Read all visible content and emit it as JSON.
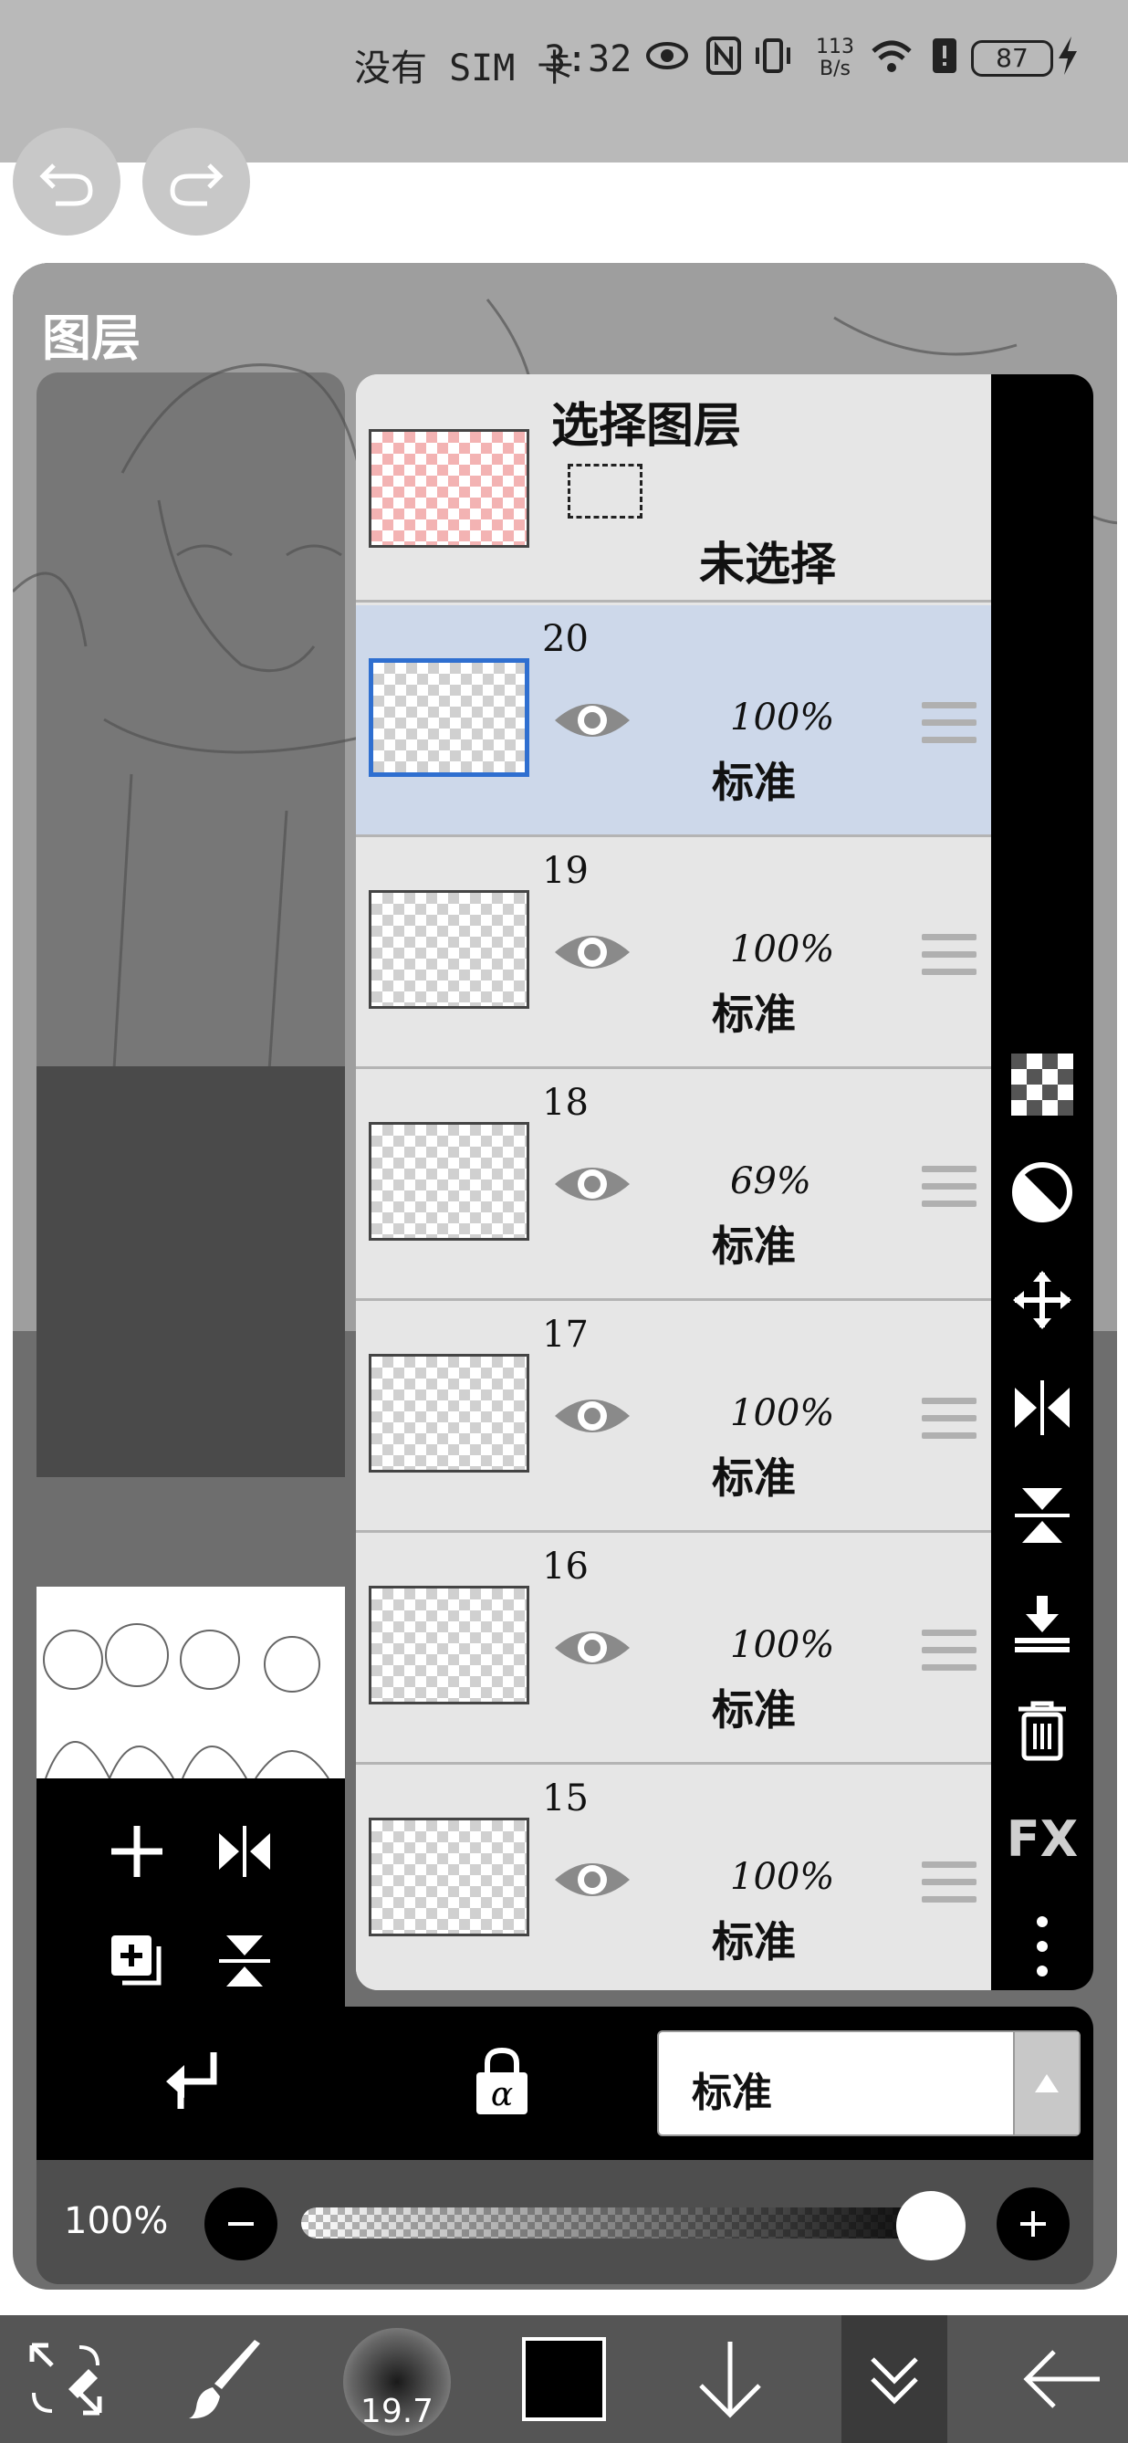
{
  "status_bar": {
    "carrier": "没有 SIM 卡",
    "time": "3:32",
    "net_speed_top": "113",
    "net_speed_bottom": "B/s",
    "battery": "87"
  },
  "panel": {
    "title": "图层"
  },
  "selection_layer": {
    "title": "选择图层",
    "state": "未选择"
  },
  "layers": [
    {
      "name": "20",
      "opacity": "100%",
      "mode": "标准",
      "active": true
    },
    {
      "name": "19",
      "opacity": "100%",
      "mode": "标准",
      "active": false
    },
    {
      "name": "18",
      "opacity": "69%",
      "mode": "标准",
      "active": false
    },
    {
      "name": "17",
      "opacity": "100%",
      "mode": "标准",
      "active": false
    },
    {
      "name": "16",
      "opacity": "100%",
      "mode": "标准",
      "active": false
    },
    {
      "name": "15",
      "opacity": "100%",
      "mode": "标准",
      "active": false
    }
  ],
  "sidebar": {
    "fx_label": "FX"
  },
  "blend_mode": {
    "selected": "标准"
  },
  "opacity_control": {
    "label": "100%",
    "value_fraction": 1.0
  },
  "toolbar": {
    "brush_size": "19.7",
    "color": "#000000"
  },
  "colors": {
    "active_layer_bg": "#cdd8ea",
    "active_thumb_border": "#2f6fd0",
    "panel_bg": "#6e6e6e"
  }
}
